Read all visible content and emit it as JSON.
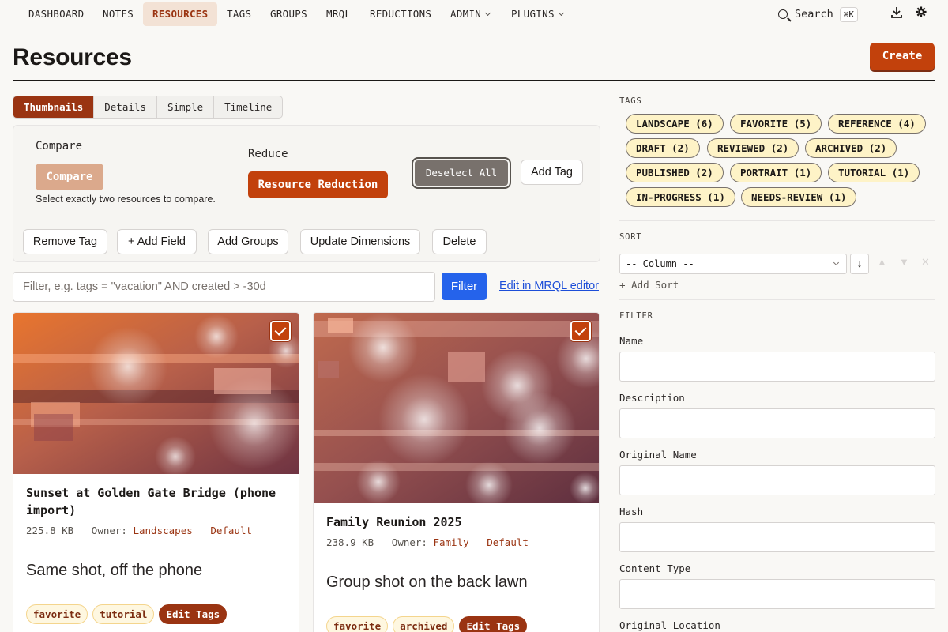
{
  "nav": {
    "items": [
      {
        "label": "DASHBOARD"
      },
      {
        "label": "NOTES"
      },
      {
        "label": "RESOURCES",
        "active": true
      },
      {
        "label": "TAGS"
      },
      {
        "label": "GROUPS"
      },
      {
        "label": "MRQL"
      },
      {
        "label": "REDUCTIONS"
      },
      {
        "label": "ADMIN",
        "dropdown": true
      },
      {
        "label": "PLUGINS",
        "dropdown": true
      }
    ],
    "search_label": "Search",
    "search_shortcut": "⌘K",
    "download_icon": "download-icon",
    "settings_icon": "gear-icon"
  },
  "page": {
    "title": "Resources",
    "create_label": "Create"
  },
  "view_tabs": [
    "Thumbnails",
    "Details",
    "Simple",
    "Timeline"
  ],
  "bulk": {
    "compare_heading": "Compare",
    "compare_button": "Compare",
    "compare_hint": "Select exactly two resources to compare.",
    "reduce_heading": "Reduce",
    "reduce_button": "Resource Reduction",
    "deselect_all": "Deselect All",
    "add_tag": "Add Tag",
    "remove_tag": "Remove Tag",
    "add_field": "+ Add Field",
    "add_groups": "Add Groups",
    "update_dimensions": "Update Dimensions",
    "delete": "Delete"
  },
  "filter": {
    "placeholder": "Filter, e.g. tags = \"vacation\" AND created > -30d",
    "button": "Filter",
    "mrql_link": "Edit in MRQL editor"
  },
  "cards": [
    {
      "title": "Sunset at Golden Gate Bridge (phone import)",
      "size": "225.8 KB",
      "owner_label": "Owner:",
      "owner": "Landscapes",
      "category": "Default",
      "description": "Same shot, off the phone",
      "tags": [
        "favorite",
        "tutorial"
      ],
      "edit_tags": "Edit Tags",
      "selected": true
    },
    {
      "title": "Family Reunion 2025",
      "size": "238.9 KB",
      "owner_label": "Owner:",
      "owner": "Family",
      "category": "Default",
      "description": "Group shot on the back lawn",
      "tags": [
        "favorite",
        "archived"
      ],
      "edit_tags": "Edit Tags",
      "selected": true
    }
  ],
  "sidebar": {
    "tags_heading": "TAGS",
    "tags": [
      "LANDSCAPE (6)",
      "FAVORITE (5)",
      "REFERENCE (4)",
      "DRAFT (2)",
      "REVIEWED (2)",
      "ARCHIVED (2)",
      "PUBLISHED (2)",
      "PORTRAIT (1)",
      "TUTORIAL (1)",
      "IN-PROGRESS (1)",
      "NEEDS-REVIEW (1)"
    ],
    "sort_heading": "SORT",
    "sort_column": "-- Column --",
    "sort_direction": "↓",
    "add_sort": "+ Add Sort",
    "filter_heading": "FILTER",
    "filter_fields": [
      "Name",
      "Description",
      "Original Name",
      "Hash",
      "Content Type",
      "Original Location"
    ]
  },
  "colors": {
    "accent": "#c2410c",
    "accent_dark": "#9a3412",
    "link": "#1d4ed8",
    "filter_button": "#2563eb"
  }
}
